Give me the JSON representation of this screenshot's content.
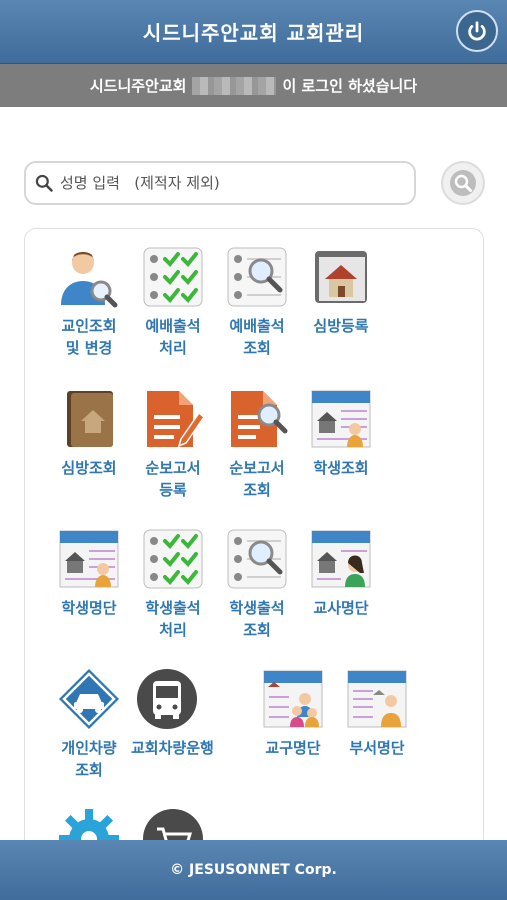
{
  "header": {
    "title": "시드니주안교회 교회관리",
    "power_icon": "power-icon"
  },
  "login_bar": {
    "prefix": "시드니주안교회",
    "suffix": "이 로그인 하셨습니다"
  },
  "search": {
    "placeholder": "성명 입력   (제적자 제외)",
    "value": ""
  },
  "menu": [
    {
      "label": "교인조회\n및 변경",
      "icon": "member-search-icon"
    },
    {
      "label": "예배출석\n처리",
      "icon": "attendance-check-icon"
    },
    {
      "label": "예배출석\n조회",
      "icon": "attendance-search-icon"
    },
    {
      "label": "심방등록",
      "icon": "house-visit-icon"
    },
    {
      "label": "심방조회",
      "icon": "visit-folder-icon"
    },
    {
      "label": "순보고서\n등록",
      "icon": "report-edit-icon"
    },
    {
      "label": "순보고서\n조회",
      "icon": "report-search-icon"
    },
    {
      "label": "학생조회",
      "icon": "student-board-icon"
    },
    {
      "label": "학생명단",
      "icon": "student-list-icon"
    },
    {
      "label": "학생출석\n처리",
      "icon": "student-attendance-check-icon"
    },
    {
      "label": "학생출석\n조회",
      "icon": "student-attendance-search-icon"
    },
    {
      "label": "교사명단",
      "icon": "teacher-list-icon"
    },
    {
      "label": "개인차량\n조회",
      "icon": "car-sign-icon"
    },
    {
      "label": "교회차량운행",
      "icon": "bus-icon"
    },
    {
      "label": "교구명단",
      "icon": "parish-list-icon"
    },
    {
      "label": "부서명단",
      "icon": "department-list-icon"
    },
    {
      "label": "",
      "icon": "gear-icon"
    },
    {
      "label": "",
      "icon": "cart-icon"
    }
  ],
  "footer": {
    "text": "© JESUSONNET Corp."
  }
}
